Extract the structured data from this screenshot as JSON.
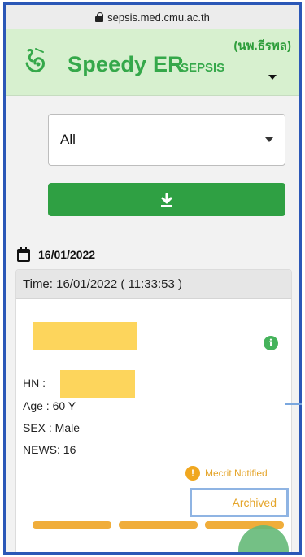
{
  "browser": {
    "url": "sepsis.med.cmu.ac.th"
  },
  "header": {
    "user": "(นพ.ธีรพล)",
    "brand": "Speedy ER",
    "brand_sub": "SEPSIS"
  },
  "filter": {
    "selected": "All"
  },
  "date_group": {
    "date": "16/01/2022"
  },
  "card": {
    "time": "Time: 16/01/2022 ( 11:33:53 )",
    "hn_label": "HN :",
    "age": "Age : 60 Y",
    "sex": "SEX : Male",
    "news": "NEWS: 16",
    "mecrit": "Mecrit Notified",
    "status": "Archived"
  },
  "colors": {
    "brand_green": "#35a84a",
    "header_bg": "#d7f0cf",
    "button_green": "#2fa043",
    "warning_orange": "#f0a71f",
    "highlight_border": "#8fb4e3"
  },
  "icons": [
    "lock-icon",
    "app-logo-icon",
    "dropdown-caret-icon",
    "download-icon",
    "calendar-icon",
    "info-icon",
    "warning-icon"
  ]
}
